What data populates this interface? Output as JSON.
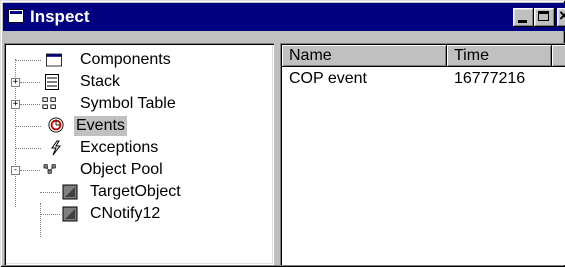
{
  "window": {
    "title": "Inspect"
  },
  "tree": {
    "items": [
      {
        "label": "Components",
        "icon": "components-icon",
        "expander": ""
      },
      {
        "label": "Stack",
        "icon": "stack-icon",
        "expander": "+"
      },
      {
        "label": "Symbol Table",
        "icon": "symbol-table-icon",
        "expander": "+"
      },
      {
        "label": "Events",
        "icon": "events-icon",
        "expander": "",
        "selected": true
      },
      {
        "label": "Exceptions",
        "icon": "exceptions-icon",
        "expander": ""
      },
      {
        "label": "Object Pool",
        "icon": "object-pool-icon",
        "expander": "-"
      },
      {
        "label": "TargetObject",
        "icon": "object-icon",
        "expander": ""
      },
      {
        "label": "CNotify12",
        "icon": "object-icon",
        "expander": ""
      }
    ]
  },
  "list": {
    "columns": [
      "Name",
      "Time"
    ],
    "rows": [
      {
        "name": "COP event",
        "time": "16777216"
      }
    ]
  }
}
